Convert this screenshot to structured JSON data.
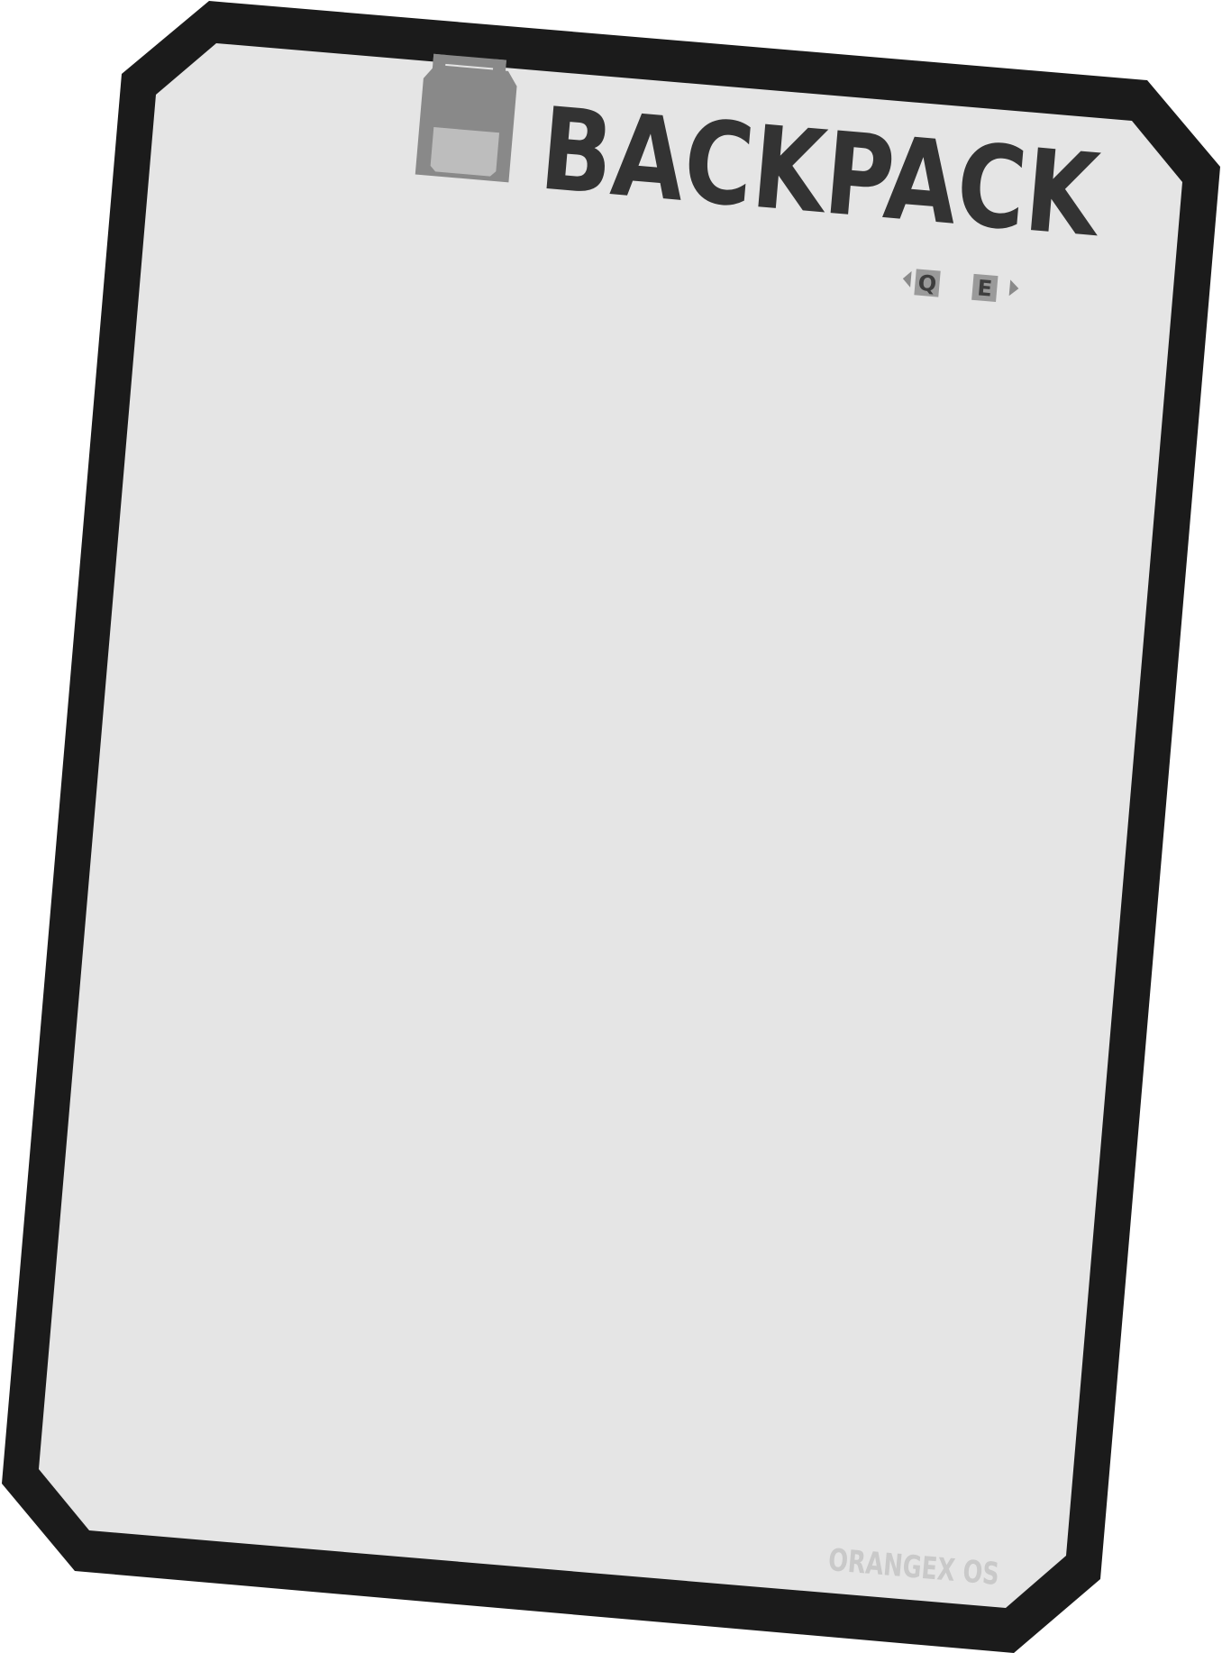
{
  "backpack": {
    "title": "BACKPACK",
    "prev_key": "Q",
    "next_key": "E"
  },
  "footer": {
    "os_name": "ORANGEX OS"
  },
  "colors": {
    "frame": "#1b1b1b",
    "panel": "#e5e5e5",
    "title": "#333333",
    "icon_body": "#898989",
    "icon_pocket": "#bdbdbd",
    "key_bg": "#9a9a9a",
    "watermark": "#c9c9c9"
  },
  "icons": {
    "title_icon": "backpack-icon",
    "prev": "triangle-left-icon",
    "next": "triangle-right-icon"
  }
}
